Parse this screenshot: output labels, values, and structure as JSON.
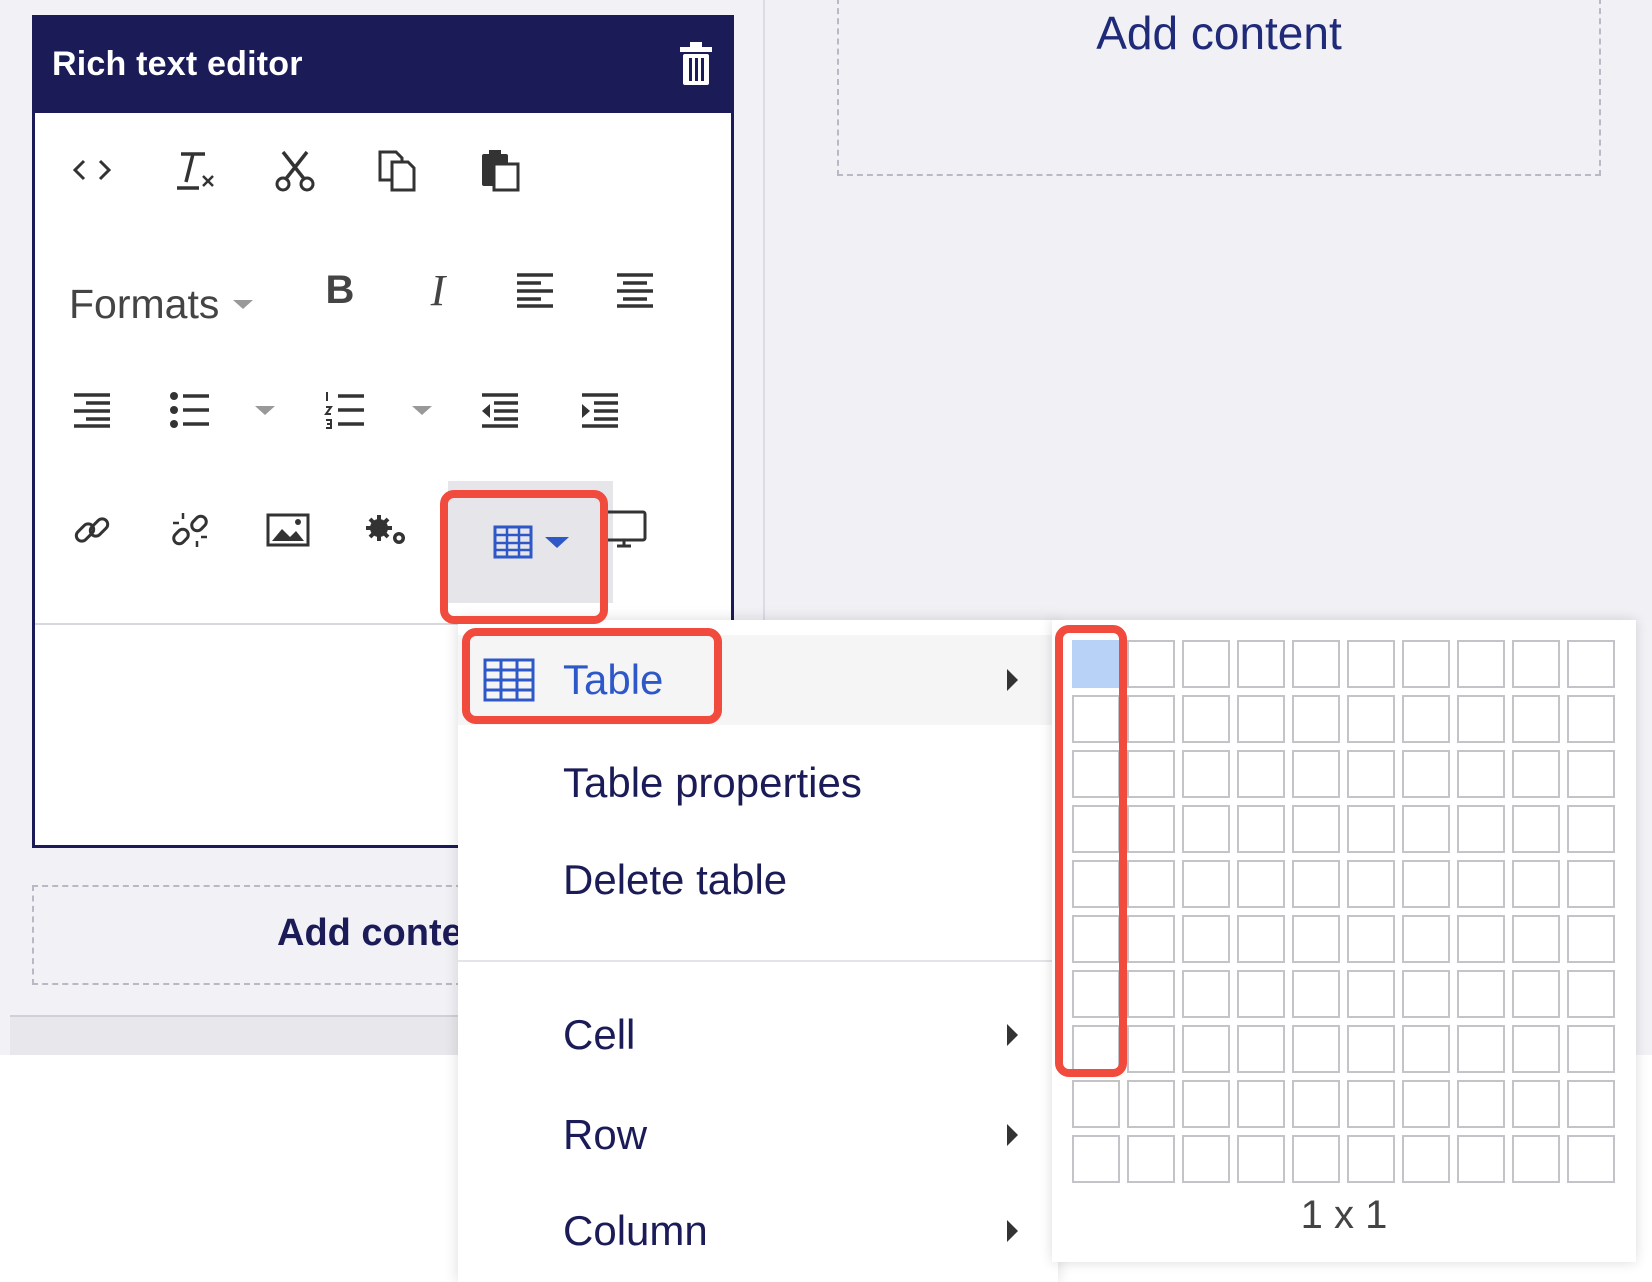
{
  "editor": {
    "title": "Rich text editor",
    "formats_label": "Formats",
    "bold_label": "B",
    "italic_label": "I"
  },
  "add_content": {
    "top_label": "Add content",
    "bottom_label": "Add conte"
  },
  "table_menu": {
    "table_label": "Table",
    "table_properties_label": "Table properties",
    "delete_table_label": "Delete table",
    "cell_label": "Cell",
    "row_label": "Row",
    "column_label": "Column"
  },
  "table_picker": {
    "columns": 10,
    "rows": 10,
    "selected_columns": 1,
    "selected_rows": 1,
    "size_text": "1 x 1"
  },
  "colors": {
    "header": "#1b1b58",
    "accent": "#2e58c8",
    "highlight": "#f04b3c",
    "selected_cell": "#b8d2f7"
  },
  "icons": [
    "source-code-icon",
    "clear-formatting-icon",
    "cut-icon",
    "copy-icon",
    "paste-icon",
    "align-left-icon",
    "align-center-icon",
    "align-right-icon",
    "bullet-list-icon",
    "numbered-list-icon",
    "outdent-icon",
    "indent-icon",
    "link-icon",
    "unlink-icon",
    "image-icon",
    "settings-icon",
    "table-icon",
    "monitor-icon",
    "trash-icon"
  ]
}
